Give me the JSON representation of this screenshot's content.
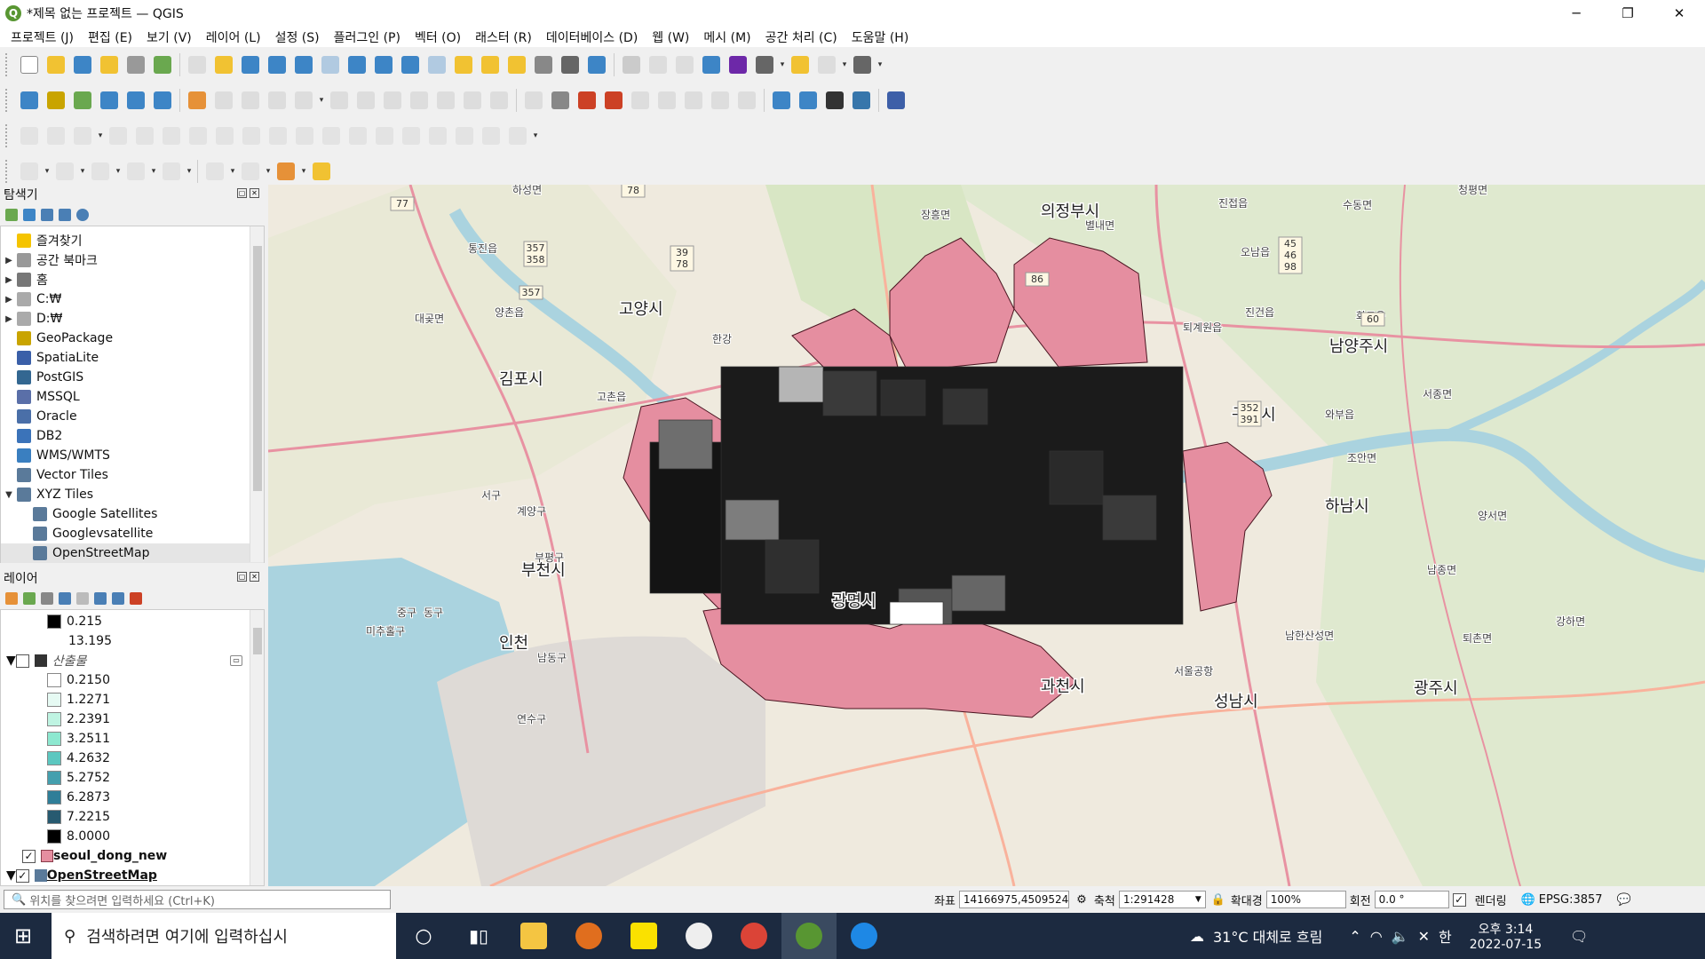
{
  "window": {
    "title": "*제목 없는 프로젝트 — QGIS",
    "app_icon": "Q"
  },
  "menu": [
    "프로젝트 (J)",
    "편집 (E)",
    "보기 (V)",
    "레이어 (L)",
    "설정 (S)",
    "플러그인 (P)",
    "벡터 (O)",
    "래스터 (R)",
    "데이터베이스 (D)",
    "웹 (W)",
    "메시 (M)",
    "공간 처리 (C)",
    "도움말 (H)"
  ],
  "browser": {
    "title": "탐색기",
    "items": [
      {
        "label": "즐겨찾기",
        "arrow": "",
        "icon": "star-icon",
        "color": "#f5c400"
      },
      {
        "label": "공간 북마크",
        "arrow": "▶",
        "icon": "bookmark-icon",
        "color": "#999"
      },
      {
        "label": "홈",
        "arrow": "▶",
        "icon": "home-icon",
        "color": "#777"
      },
      {
        "label": "C:₩",
        "arrow": "▶",
        "icon": "drive-icon",
        "color": "#aaa"
      },
      {
        "label": "D:₩",
        "arrow": "▶",
        "icon": "drive-icon",
        "color": "#aaa"
      },
      {
        "label": "GeoPackage",
        "arrow": "",
        "icon": "geopackage-icon",
        "color": "#c9a400"
      },
      {
        "label": "SpatiaLite",
        "arrow": "",
        "icon": "spatialite-icon",
        "color": "#3a5fa8"
      },
      {
        "label": "PostGIS",
        "arrow": "",
        "icon": "postgis-icon",
        "color": "#336791"
      },
      {
        "label": "MSSQL",
        "arrow": "",
        "icon": "mssql-icon",
        "color": "#5a6fa8"
      },
      {
        "label": "Oracle",
        "arrow": "",
        "icon": "oracle-icon",
        "color": "#4a6fa8"
      },
      {
        "label": "DB2",
        "arrow": "",
        "icon": "db2-icon",
        "color": "#3b73b9"
      },
      {
        "label": "WMS/WMTS",
        "arrow": "",
        "icon": "globe-icon",
        "color": "#3a7fc0"
      },
      {
        "label": "Vector Tiles",
        "arrow": "",
        "icon": "grid-icon",
        "color": "#5a7a9a"
      },
      {
        "label": "XYZ Tiles",
        "arrow": "▼",
        "icon": "grid-icon",
        "color": "#5a7a9a"
      }
    ],
    "xyz_children": [
      "Google Satellites",
      "Googlevsatellite",
      "OpenStreetMap"
    ]
  },
  "layers": {
    "title": "레이어",
    "top_items": [
      {
        "label": "0.215",
        "color": "#000000"
      },
      {
        "label": "13.195",
        "color": ""
      }
    ],
    "group_label": "산출물",
    "legend": [
      {
        "label": "0.2150",
        "color": "#ffffff"
      },
      {
        "label": "1.2271",
        "color": "#e6faf3"
      },
      {
        "label": "2.2391",
        "color": "#bff4e2"
      },
      {
        "label": "3.2511",
        "color": "#8de8d0"
      },
      {
        "label": "4.2632",
        "color": "#5cc7c0"
      },
      {
        "label": "5.2752",
        "color": "#449fae"
      },
      {
        "label": "6.2873",
        "color": "#2f7e98"
      },
      {
        "label": "7.2215",
        "color": "#275a70"
      },
      {
        "label": "8.0000",
        "color": "#000000"
      }
    ],
    "vector_layer": "seoul_dong_new",
    "basemap_layer": "OpenStreetMap"
  },
  "map": {
    "labels": [
      {
        "t": "의정부시",
        "big": true
      },
      {
        "t": "고양시",
        "big": true
      },
      {
        "t": "김포시",
        "big": true
      },
      {
        "t": "남양주시",
        "big": true
      },
      {
        "t": "구리시",
        "big": true
      },
      {
        "t": "하남시",
        "big": true
      },
      {
        "t": "부천시",
        "big": true
      },
      {
        "t": "인천",
        "big": true
      },
      {
        "t": "광명시",
        "big": true
      },
      {
        "t": "과천시",
        "big": true
      },
      {
        "t": "성남시",
        "big": true
      },
      {
        "t": "광주시",
        "big": true
      },
      {
        "t": "하성면",
        "big": false
      },
      {
        "t": "통진읍",
        "big": false
      },
      {
        "t": "대곶면",
        "big": false
      },
      {
        "t": "양촌읍",
        "big": false
      },
      {
        "t": "고촌읍",
        "big": false
      },
      {
        "t": "장흥면",
        "big": false
      },
      {
        "t": "별내면",
        "big": false
      },
      {
        "t": "진접읍",
        "big": false
      },
      {
        "t": "오남읍",
        "big": false
      },
      {
        "t": "수동면",
        "big": false
      },
      {
        "t": "청평면",
        "big": false
      },
      {
        "t": "퇴계원읍",
        "big": false
      },
      {
        "t": "진건읍",
        "big": false
      },
      {
        "t": "화도읍",
        "big": false
      },
      {
        "t": "서종면",
        "big": false
      },
      {
        "t": "와부읍",
        "big": false
      },
      {
        "t": "조안면",
        "big": false
      },
      {
        "t": "양서면",
        "big": false
      },
      {
        "t": "남종면",
        "big": false
      },
      {
        "t": "강하면",
        "big": false
      },
      {
        "t": "퇴촌면",
        "big": false
      },
      {
        "t": "남한산성면",
        "big": false
      },
      {
        "t": "서구",
        "big": false
      },
      {
        "t": "계양구",
        "big": false
      },
      {
        "t": "부평구",
        "big": false
      },
      {
        "t": "중구",
        "big": false
      },
      {
        "t": "동구",
        "big": false
      },
      {
        "t": "미추홀구",
        "big": false
      },
      {
        "t": "남동구",
        "big": false
      },
      {
        "t": "연수구",
        "big": false
      },
      {
        "t": "한강",
        "big": false
      },
      {
        "t": "서울공항",
        "big": false
      }
    ],
    "routes": [
      "77",
      "78",
      "357\n358",
      "357",
      "39\n78",
      "86",
      "45\n46\n98",
      "60",
      "352\n391"
    ]
  },
  "status": {
    "search_placeholder": "위치를 찾으려면 입력하세요 (Ctrl+K)",
    "coord_label": "좌표",
    "coord_value": "14166975,4509524",
    "scale_label": "축척",
    "scale_value": "1:291428",
    "magnifier_label": "확대경",
    "magnifier_value": "100%",
    "rotation_label": "회전",
    "rotation_value": "0.0 °",
    "render_label": "렌더링",
    "crs": "EPSG:3857"
  },
  "taskbar": {
    "search_placeholder": "검색하려면 여기에 입력하십시",
    "weather": "31°C  대체로 흐림",
    "ime": "한",
    "time": "오후 3:14",
    "date": "2022-07-15"
  }
}
